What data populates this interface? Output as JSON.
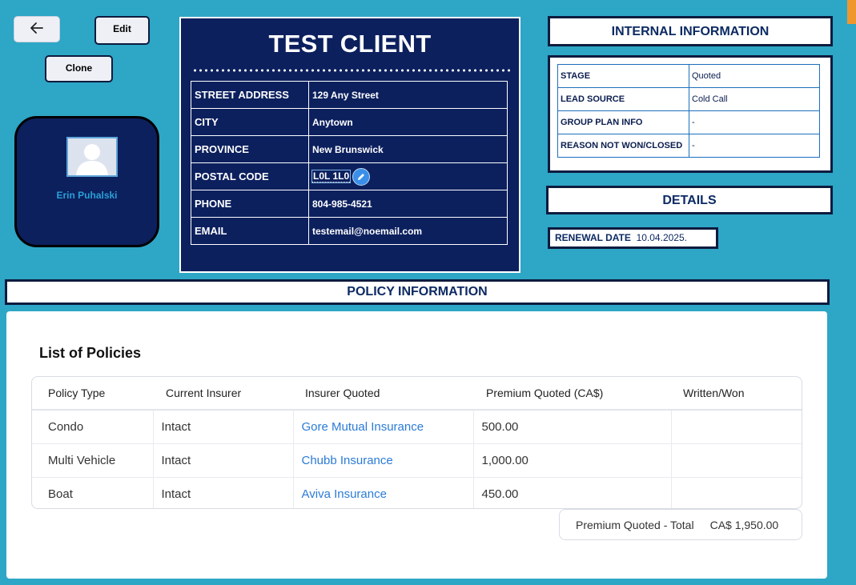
{
  "actions": {
    "back_icon": "arrow-left-icon",
    "edit_label": "Edit",
    "clone_label": "Clone"
  },
  "avatar": {
    "name": "Erin Puhalski"
  },
  "client": {
    "title": "TEST CLIENT",
    "rows": [
      {
        "label": "STREET ADDRESS",
        "value": "129 Any Street"
      },
      {
        "label": "CITY",
        "value": "Anytown"
      },
      {
        "label": "PROVINCE",
        "value": "New Brunswick"
      },
      {
        "label": "POSTAL CODE",
        "value": "L0L 1L0"
      },
      {
        "label": "PHONE",
        "value": "804-985-4521"
      },
      {
        "label": "EMAIL",
        "value": "testemail@noemail.com"
      }
    ]
  },
  "internal": {
    "title": "INTERNAL INFORMATION",
    "rows": [
      {
        "label": "STAGE",
        "value": "Quoted"
      },
      {
        "label": "LEAD SOURCE",
        "value": "Cold Call"
      },
      {
        "label": "GROUP PLAN INFO",
        "value": "-"
      },
      {
        "label": "REASON NOT WON/CLOSED",
        "value": "-"
      }
    ]
  },
  "details": {
    "title": "DETAILS",
    "renewal_label": "RENEWAL DATE",
    "renewal_value": "10.04.2025."
  },
  "policy": {
    "title": "POLICY INFORMATION",
    "list_title": "List of Policies",
    "columns": [
      "Policy Type",
      "Current Insurer",
      "Insurer Quoted",
      "Premium Quoted (CA$)",
      "Written/Won"
    ],
    "rows": [
      {
        "type": "Condo",
        "current": "Intact",
        "quoted": "Gore Mutual Insurance",
        "premium": "500.00",
        "won": ""
      },
      {
        "type": "Multi Vehicle",
        "current": "Intact",
        "quoted": "Chubb Insurance",
        "premium": "1,000.00",
        "won": ""
      },
      {
        "type": "Boat",
        "current": "Intact",
        "quoted": "Aviva Insurance",
        "premium": "450.00",
        "won": ""
      }
    ],
    "total_label": "Premium Quoted - Total",
    "total_value": "CA$ 1,950.00"
  },
  "colors": {
    "background": "#2ea6c6",
    "panel_navy": "#0c205e",
    "link": "#2b7bd6",
    "accent": "#f0962e"
  }
}
